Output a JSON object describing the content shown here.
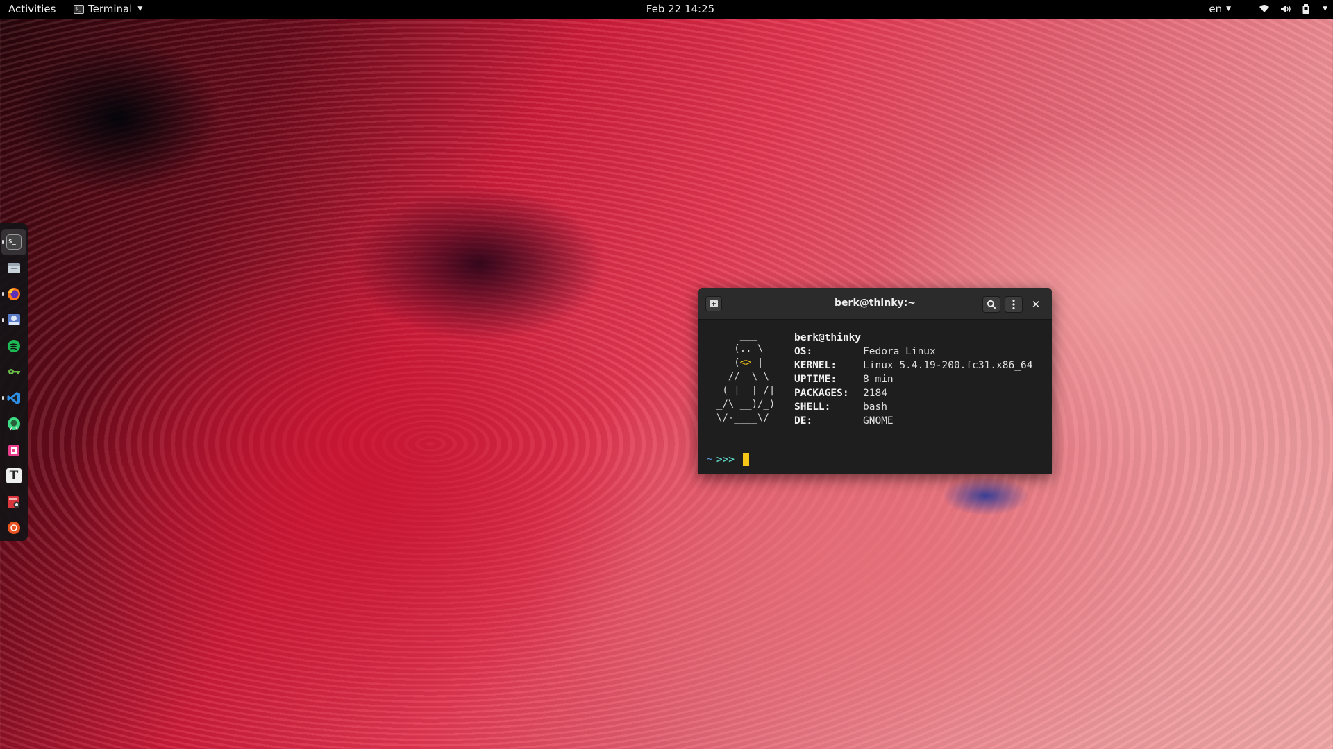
{
  "topbar": {
    "activities": "Activities",
    "app_name": "Terminal",
    "clock": "Feb 22  14:25",
    "language": "en"
  },
  "dock": {
    "items": [
      {
        "name": "terminal",
        "active": true,
        "running": true
      },
      {
        "name": "files",
        "running": false
      },
      {
        "name": "firefox",
        "running": true
      },
      {
        "name": "mail",
        "running": true
      },
      {
        "name": "spotify",
        "running": false
      },
      {
        "name": "passwords-keys",
        "running": false
      },
      {
        "name": "vscode",
        "running": true
      },
      {
        "name": "android-studio",
        "running": false
      },
      {
        "name": "app-store",
        "running": false
      },
      {
        "name": "typora",
        "running": false
      },
      {
        "name": "screenshot-tool",
        "running": false
      },
      {
        "name": "ubuntu-software",
        "running": false
      }
    ]
  },
  "terminal": {
    "title": "berk@thinky:~",
    "user_host": "berk@thinky",
    "info": [
      {
        "key": "OS:",
        "value": "Fedora Linux"
      },
      {
        "key": "KERNEL:",
        "value": "Linux 5.4.19-200.fc31.x86_64"
      },
      {
        "key": "UPTIME:",
        "value": "8 min"
      },
      {
        "key": "PACKAGES:",
        "value": "2184"
      },
      {
        "key": "SHELL:",
        "value": "bash"
      },
      {
        "key": "DE:",
        "value": "GNOME"
      }
    ],
    "prompt_dir": "~",
    "prompt_symbol": ">>>"
  },
  "colors": {
    "topbar_bg": "#000000",
    "terminal_bg": "#1e1e1e",
    "cursor": "#f5c518"
  }
}
